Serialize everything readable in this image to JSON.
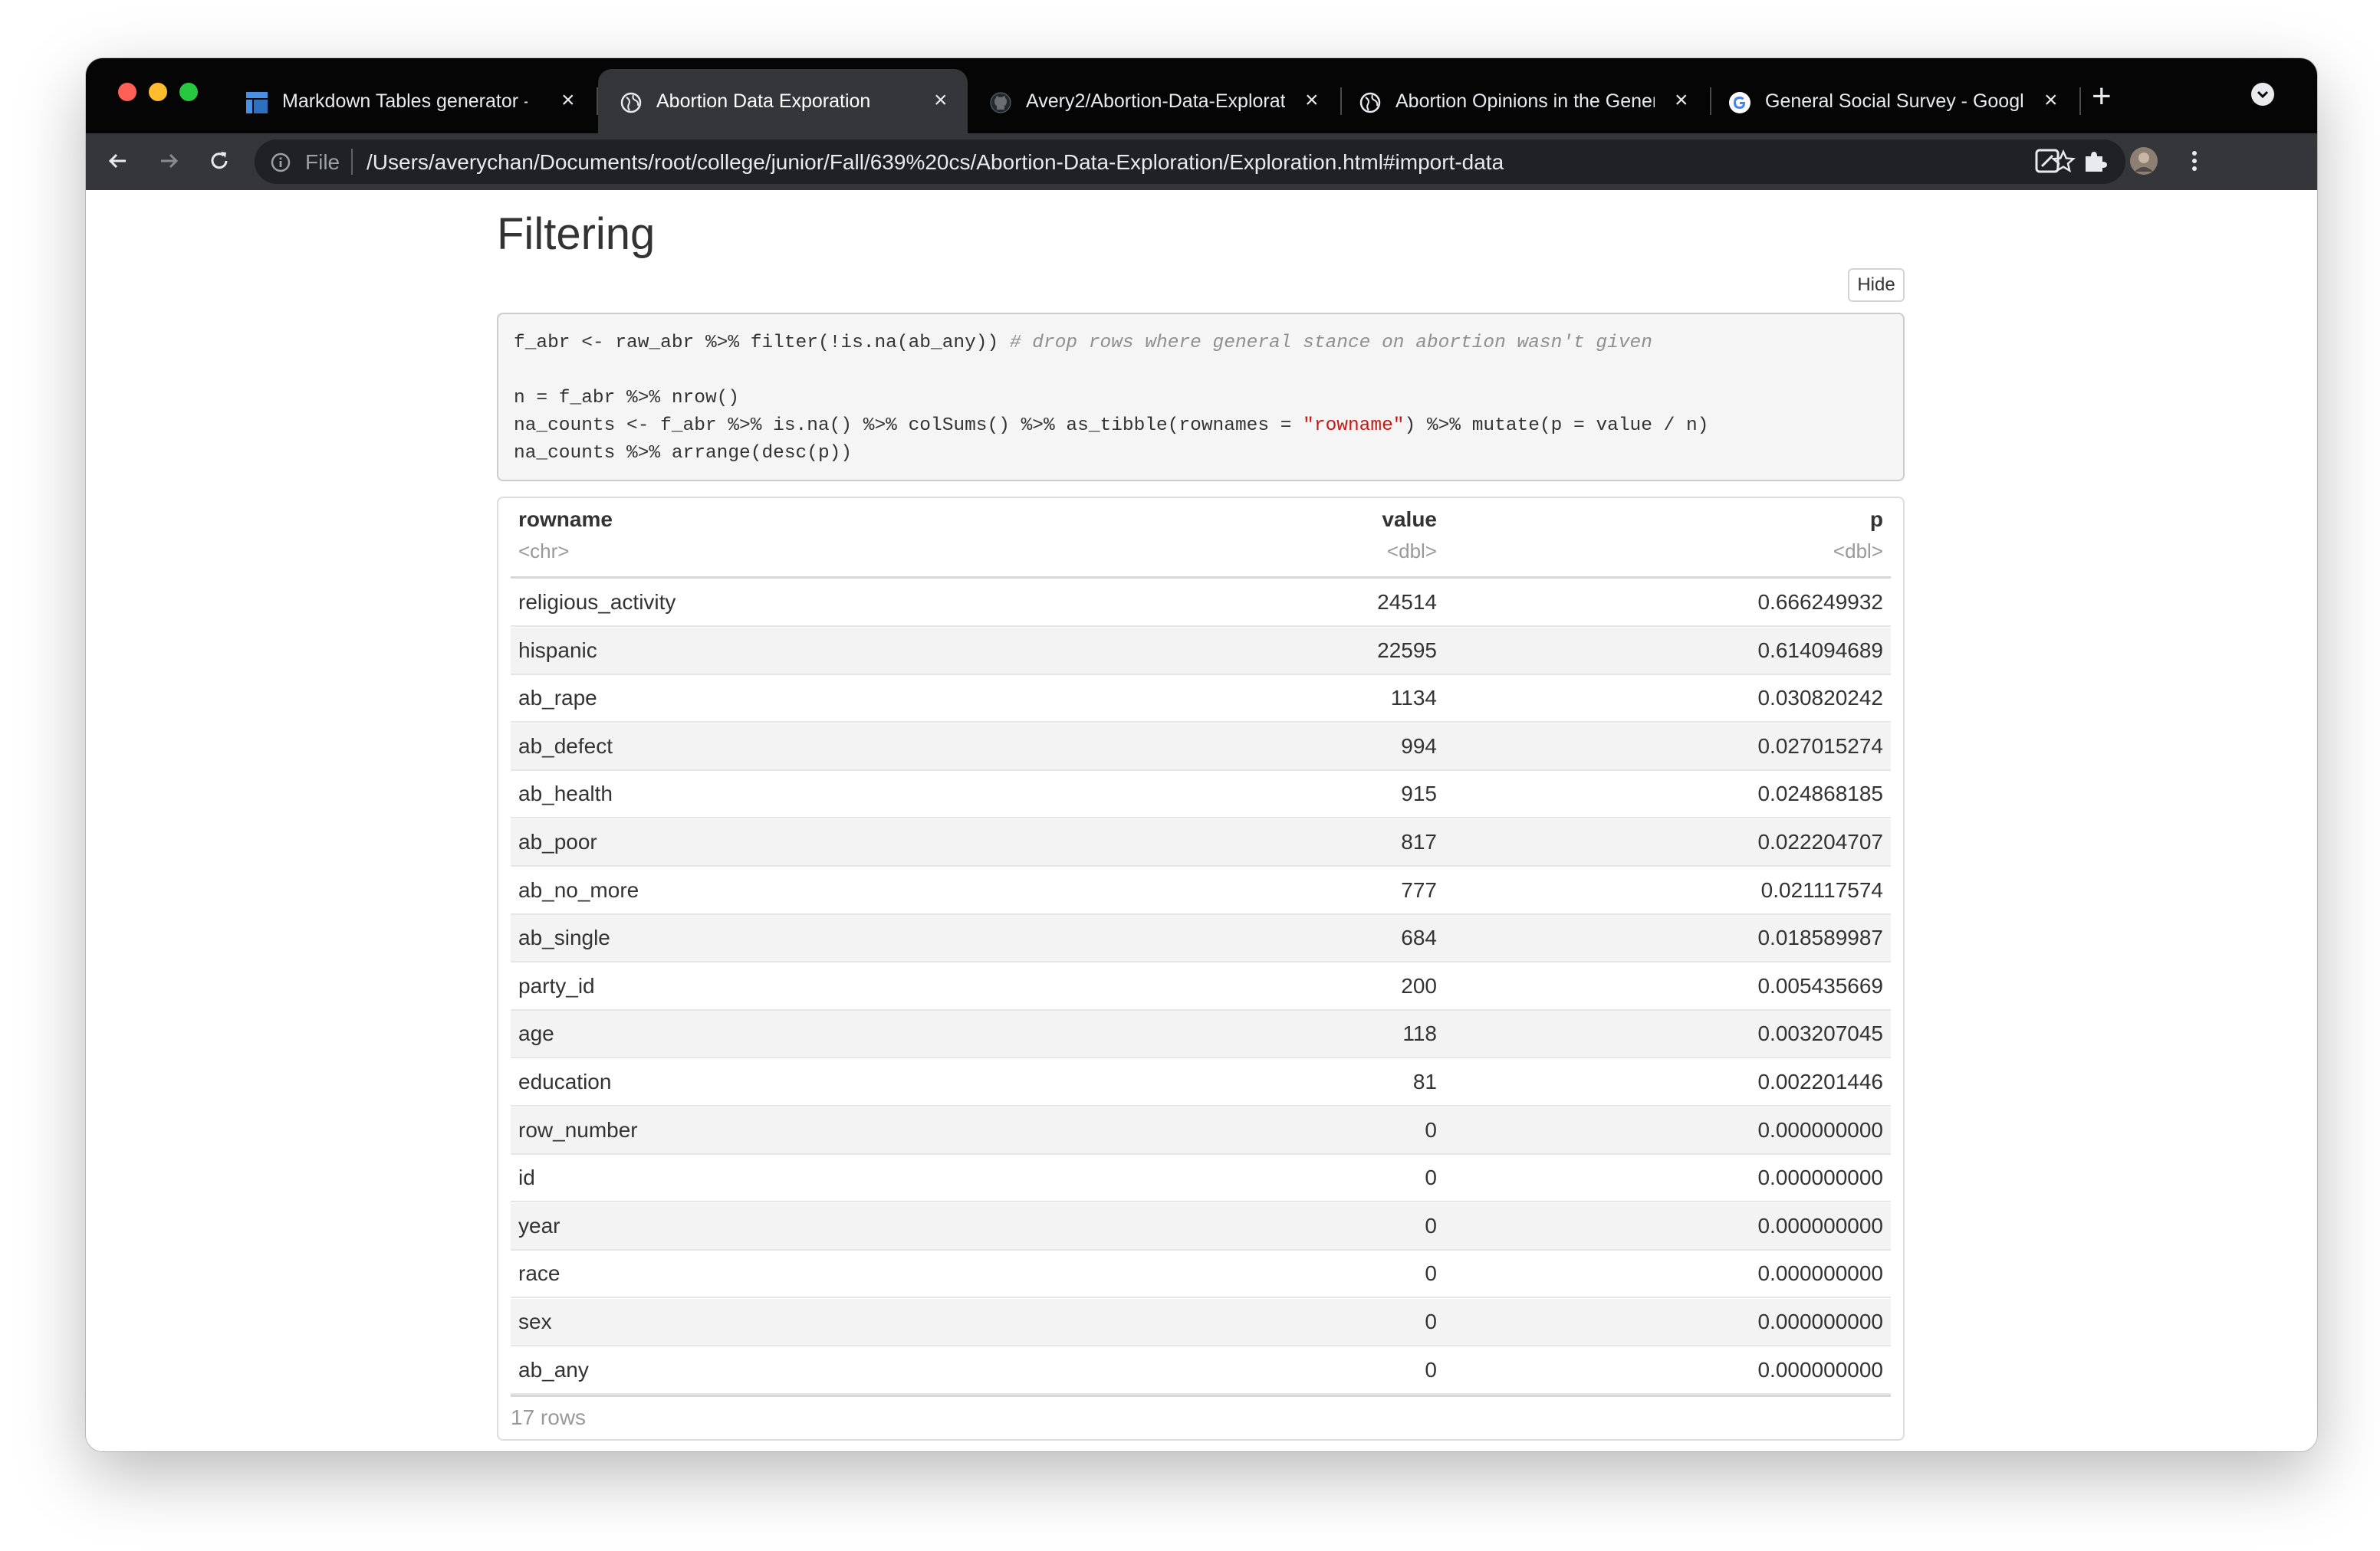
{
  "browser": {
    "tabs": [
      {
        "label": "Markdown Tables generator - T",
        "active": false,
        "favicon": "table-grid-icon"
      },
      {
        "label": "Abortion Data Exporation",
        "active": true,
        "favicon": "globe-icon"
      },
      {
        "label": "Avery2/Abortion-Data-Explorat",
        "active": false,
        "favicon": "github-icon"
      },
      {
        "label": "Abortion Opinions in the Gener",
        "active": false,
        "favicon": "globe-icon"
      },
      {
        "label": "General Social Survey - Google",
        "active": false,
        "favicon": "google-icon"
      }
    ],
    "file_label": "File",
    "url": "/Users/averychan/Documents/root/college/junior/Fall/639%20cs/Abortion-Data-Exploration/Exploration.html#import-data"
  },
  "page": {
    "title": "Filtering",
    "hide_button": "Hide",
    "code": {
      "line1_code": "f_abr <- raw_abr %>% filter(!is.na(ab_any)) ",
      "line1_comment": "# drop rows where general stance on abortion wasn't given",
      "line2": "n = f_abr %>% nrow()",
      "line3_pre": "na_counts <- f_abr %>% is.na() %>% colSums() %>% as_tibble(rownames = ",
      "line3_string": "\"rowname\"",
      "line3_post": ") %>% mutate(p = value / n)",
      "line4": "na_counts %>% arrange(desc(p))"
    },
    "table": {
      "columns": [
        {
          "name": "rowname",
          "type": "<chr>"
        },
        {
          "name": "value",
          "type": "<dbl>"
        },
        {
          "name": "p",
          "type": "<dbl>"
        }
      ],
      "rows": [
        [
          "religious_activity",
          "24514",
          "0.666249932"
        ],
        [
          "hispanic",
          "22595",
          "0.614094689"
        ],
        [
          "ab_rape",
          "1134",
          "0.030820242"
        ],
        [
          "ab_defect",
          "994",
          "0.027015274"
        ],
        [
          "ab_health",
          "915",
          "0.024868185"
        ],
        [
          "ab_poor",
          "817",
          "0.022204707"
        ],
        [
          "ab_no_more",
          "777",
          "0.021117574"
        ],
        [
          "ab_single",
          "684",
          "0.018589987"
        ],
        [
          "party_id",
          "200",
          "0.005435669"
        ],
        [
          "age",
          "118",
          "0.003207045"
        ],
        [
          "education",
          "81",
          "0.002201446"
        ],
        [
          "row_number",
          "0",
          "0.000000000"
        ],
        [
          "id",
          "0",
          "0.000000000"
        ],
        [
          "year",
          "0",
          "0.000000000"
        ],
        [
          "race",
          "0",
          "0.000000000"
        ],
        [
          "sex",
          "0",
          "0.000000000"
        ],
        [
          "ab_any",
          "0",
          "0.000000000"
        ]
      ],
      "footer": "17 rows"
    }
  }
}
